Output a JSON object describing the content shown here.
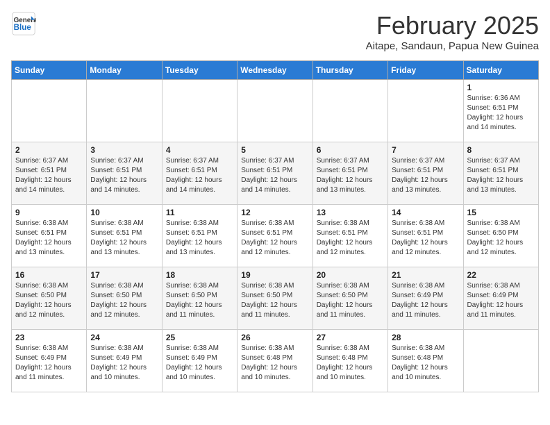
{
  "header": {
    "logo_line1": "General",
    "logo_line2": "Blue",
    "month_title": "February 2025",
    "subtitle": "Aitape, Sandaun, Papua New Guinea"
  },
  "weekdays": [
    "Sunday",
    "Monday",
    "Tuesday",
    "Wednesday",
    "Thursday",
    "Friday",
    "Saturday"
  ],
  "weeks": [
    [
      {
        "day": "",
        "info": ""
      },
      {
        "day": "",
        "info": ""
      },
      {
        "day": "",
        "info": ""
      },
      {
        "day": "",
        "info": ""
      },
      {
        "day": "",
        "info": ""
      },
      {
        "day": "",
        "info": ""
      },
      {
        "day": "1",
        "info": "Sunrise: 6:36 AM\nSunset: 6:51 PM\nDaylight: 12 hours\nand 14 minutes."
      }
    ],
    [
      {
        "day": "2",
        "info": "Sunrise: 6:37 AM\nSunset: 6:51 PM\nDaylight: 12 hours\nand 14 minutes."
      },
      {
        "day": "3",
        "info": "Sunrise: 6:37 AM\nSunset: 6:51 PM\nDaylight: 12 hours\nand 14 minutes."
      },
      {
        "day": "4",
        "info": "Sunrise: 6:37 AM\nSunset: 6:51 PM\nDaylight: 12 hours\nand 14 minutes."
      },
      {
        "day": "5",
        "info": "Sunrise: 6:37 AM\nSunset: 6:51 PM\nDaylight: 12 hours\nand 14 minutes."
      },
      {
        "day": "6",
        "info": "Sunrise: 6:37 AM\nSunset: 6:51 PM\nDaylight: 12 hours\nand 13 minutes."
      },
      {
        "day": "7",
        "info": "Sunrise: 6:37 AM\nSunset: 6:51 PM\nDaylight: 12 hours\nand 13 minutes."
      },
      {
        "day": "8",
        "info": "Sunrise: 6:37 AM\nSunset: 6:51 PM\nDaylight: 12 hours\nand 13 minutes."
      }
    ],
    [
      {
        "day": "9",
        "info": "Sunrise: 6:38 AM\nSunset: 6:51 PM\nDaylight: 12 hours\nand 13 minutes."
      },
      {
        "day": "10",
        "info": "Sunrise: 6:38 AM\nSunset: 6:51 PM\nDaylight: 12 hours\nand 13 minutes."
      },
      {
        "day": "11",
        "info": "Sunrise: 6:38 AM\nSunset: 6:51 PM\nDaylight: 12 hours\nand 13 minutes."
      },
      {
        "day": "12",
        "info": "Sunrise: 6:38 AM\nSunset: 6:51 PM\nDaylight: 12 hours\nand 12 minutes."
      },
      {
        "day": "13",
        "info": "Sunrise: 6:38 AM\nSunset: 6:51 PM\nDaylight: 12 hours\nand 12 minutes."
      },
      {
        "day": "14",
        "info": "Sunrise: 6:38 AM\nSunset: 6:51 PM\nDaylight: 12 hours\nand 12 minutes."
      },
      {
        "day": "15",
        "info": "Sunrise: 6:38 AM\nSunset: 6:50 PM\nDaylight: 12 hours\nand 12 minutes."
      }
    ],
    [
      {
        "day": "16",
        "info": "Sunrise: 6:38 AM\nSunset: 6:50 PM\nDaylight: 12 hours\nand 12 minutes."
      },
      {
        "day": "17",
        "info": "Sunrise: 6:38 AM\nSunset: 6:50 PM\nDaylight: 12 hours\nand 12 minutes."
      },
      {
        "day": "18",
        "info": "Sunrise: 6:38 AM\nSunset: 6:50 PM\nDaylight: 12 hours\nand 11 minutes."
      },
      {
        "day": "19",
        "info": "Sunrise: 6:38 AM\nSunset: 6:50 PM\nDaylight: 12 hours\nand 11 minutes."
      },
      {
        "day": "20",
        "info": "Sunrise: 6:38 AM\nSunset: 6:50 PM\nDaylight: 12 hours\nand 11 minutes."
      },
      {
        "day": "21",
        "info": "Sunrise: 6:38 AM\nSunset: 6:49 PM\nDaylight: 12 hours\nand 11 minutes."
      },
      {
        "day": "22",
        "info": "Sunrise: 6:38 AM\nSunset: 6:49 PM\nDaylight: 12 hours\nand 11 minutes."
      }
    ],
    [
      {
        "day": "23",
        "info": "Sunrise: 6:38 AM\nSunset: 6:49 PM\nDaylight: 12 hours\nand 11 minutes."
      },
      {
        "day": "24",
        "info": "Sunrise: 6:38 AM\nSunset: 6:49 PM\nDaylight: 12 hours\nand 10 minutes."
      },
      {
        "day": "25",
        "info": "Sunrise: 6:38 AM\nSunset: 6:49 PM\nDaylight: 12 hours\nand 10 minutes."
      },
      {
        "day": "26",
        "info": "Sunrise: 6:38 AM\nSunset: 6:48 PM\nDaylight: 12 hours\nand 10 minutes."
      },
      {
        "day": "27",
        "info": "Sunrise: 6:38 AM\nSunset: 6:48 PM\nDaylight: 12 hours\nand 10 minutes."
      },
      {
        "day": "28",
        "info": "Sunrise: 6:38 AM\nSunset: 6:48 PM\nDaylight: 12 hours\nand 10 minutes."
      },
      {
        "day": "",
        "info": ""
      }
    ]
  ]
}
